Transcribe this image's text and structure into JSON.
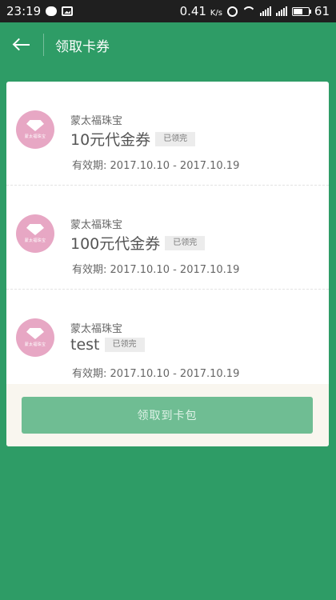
{
  "status_bar": {
    "time": "23:19",
    "speed": "0.41",
    "speed_unit": "K/s",
    "battery": "61"
  },
  "header": {
    "title": "领取卡券"
  },
  "coupons": [
    {
      "brand": "蒙太福珠宝",
      "logo_text": "蒙太福珠宝",
      "title": "10元代金券",
      "status": "已领完",
      "validity_label": "有效期:",
      "validity": "2017.10.10 - 2017.10.19"
    },
    {
      "brand": "蒙太福珠宝",
      "logo_text": "蒙太福珠宝",
      "title": "100元代金券",
      "status": "已领完",
      "validity_label": "有效期:",
      "validity": "2017.10.10 - 2017.10.19"
    },
    {
      "brand": "蒙太福珠宝",
      "logo_text": "蒙太福珠宝",
      "title": "test",
      "status": "已领完",
      "validity_label": "有效期:",
      "validity": "2017.10.10 - 2017.10.19"
    }
  ],
  "footer": {
    "button_label": "领取到卡包"
  },
  "colors": {
    "primary": "#2e9c66",
    "button": "#6fbd93",
    "logo": "#e7a7c4"
  }
}
